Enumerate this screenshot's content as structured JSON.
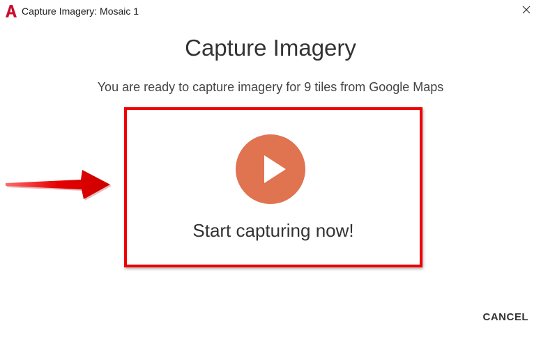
{
  "window": {
    "title": "Capture Imagery: Mosaic 1",
    "app_icon": "autocad-logo-icon",
    "close_icon": "close-icon"
  },
  "main": {
    "heading": "Capture Imagery",
    "subtitle": "You are ready to capture imagery for 9 tiles from Google Maps",
    "start_label": "Start capturing now!",
    "play_icon": "play-icon"
  },
  "footer": {
    "cancel_label": "CANCEL"
  },
  "colors": {
    "highlight_border": "#ee0000",
    "play_button": "#e07350",
    "annotation_arrow": "#e60000"
  }
}
